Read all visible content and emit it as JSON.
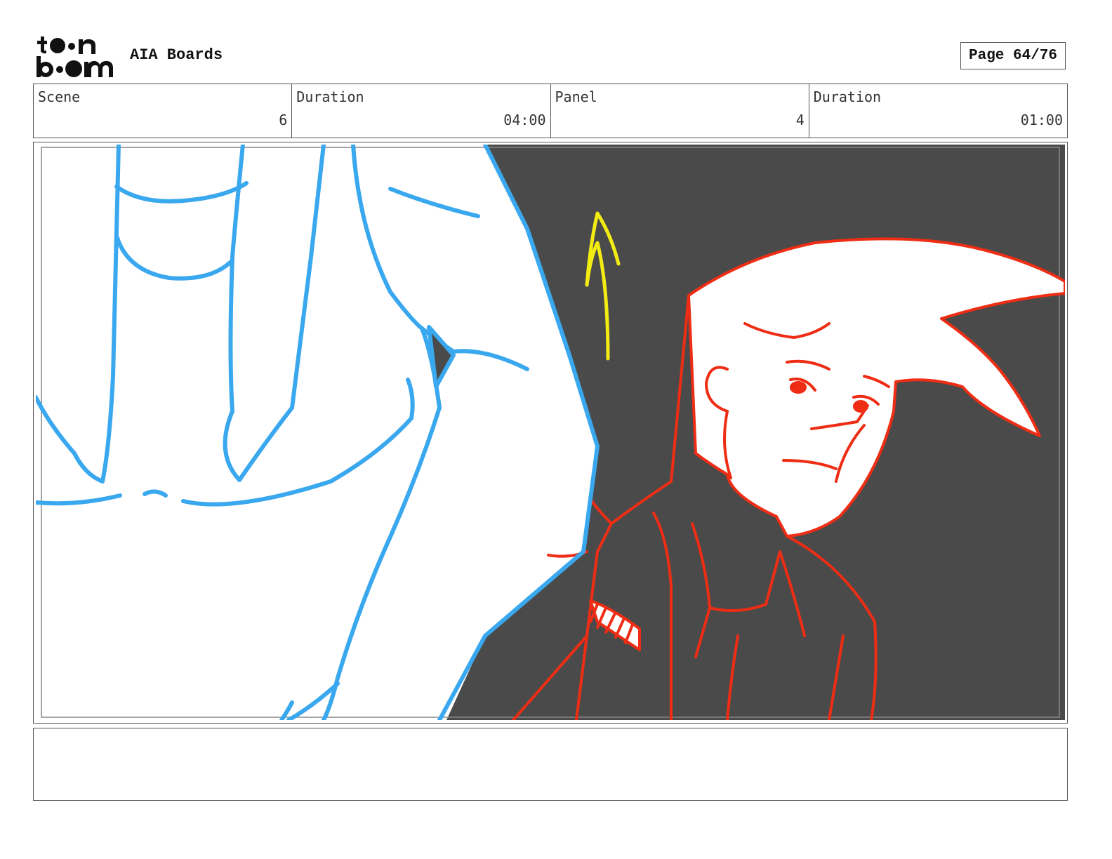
{
  "header": {
    "logo_text_top": "toon",
    "logo_text_bottom": "boom",
    "project_title": "AIA Boards",
    "page_label": "Page 64/76"
  },
  "info": {
    "scene_label": "Scene",
    "scene_value": "6",
    "scene_duration_label": "Duration",
    "scene_duration_value": "04:00",
    "panel_label": "Panel",
    "panel_value": "4",
    "panel_duration_label": "Duration",
    "panel_duration_value": "01:00"
  },
  "panel": {
    "background_color": "#4a4a4a",
    "sketch_colors": {
      "foreground_figure": "#3aa8ee",
      "character": "#ee2d14",
      "motion_arrow": "#f2ec12"
    }
  },
  "notes": {
    "text": ""
  }
}
